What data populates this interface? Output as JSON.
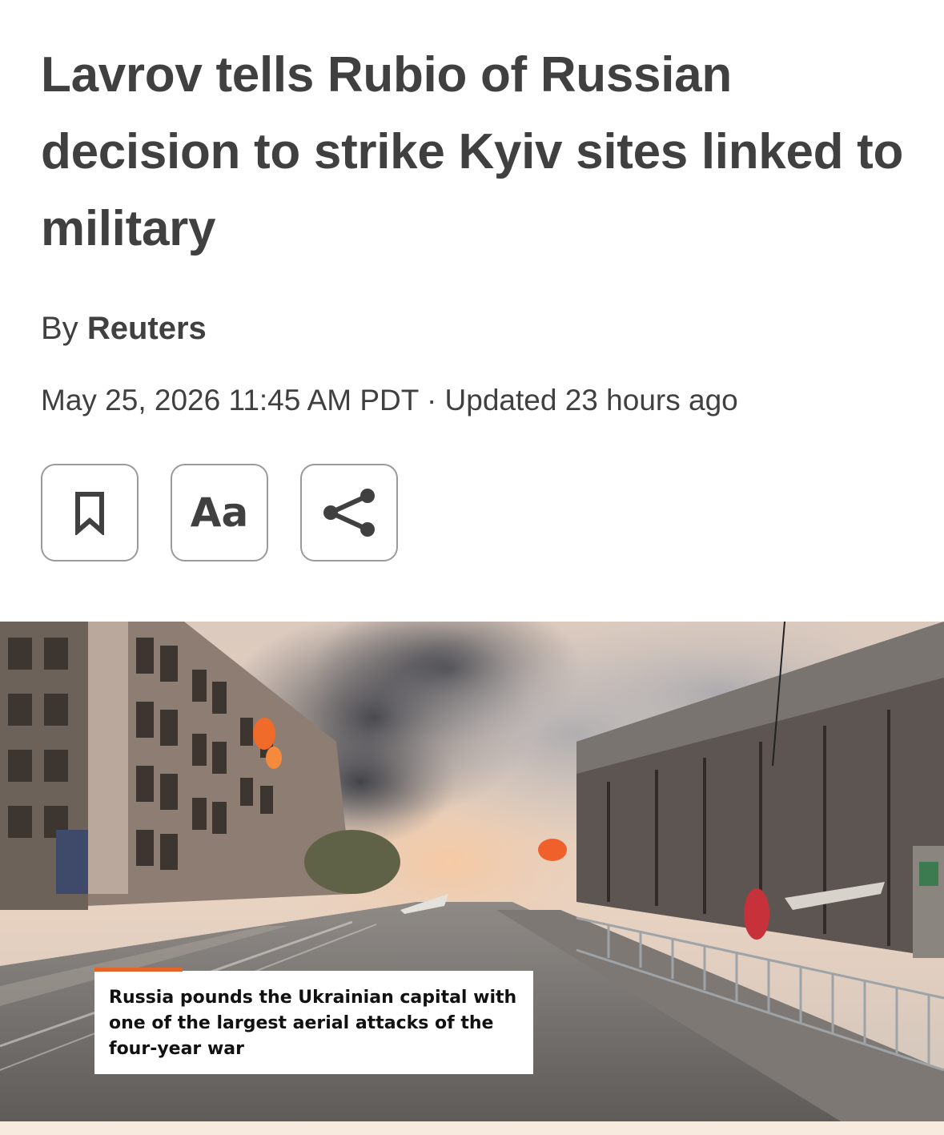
{
  "article": {
    "headline": "Lavrov tells Rubio of Russian decision to strike Kyiv sites linked to military",
    "byline_prefix": "By",
    "author": "Reuters",
    "dateline": "May 25, 2026 11:45 AM PDT · Updated 23 hours ago"
  },
  "toolbar": {
    "bookmark_icon": "bookmark-icon",
    "text_size_label": "Aa",
    "share_icon": "share-icon"
  },
  "media": {
    "type": "video",
    "caption": "Russia pounds the Ukrainian capital with one of the largest aerial attacks of the four-year war",
    "caption_accent_color": "#e5642a"
  }
}
